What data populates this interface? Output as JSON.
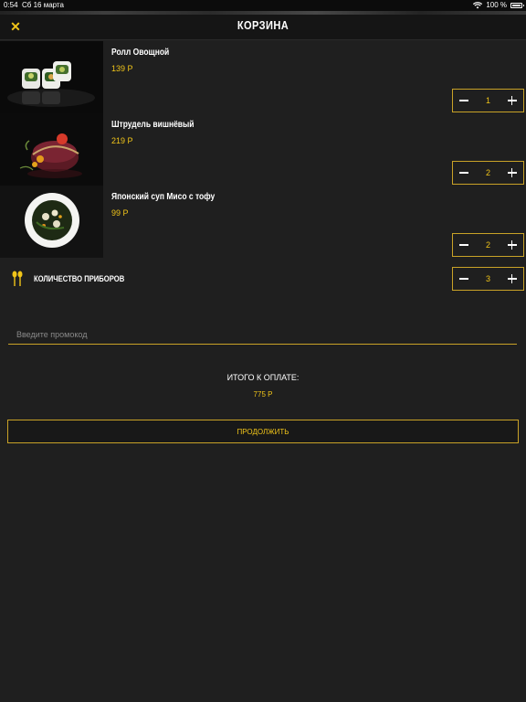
{
  "status_bar": {
    "time": "0:54",
    "date": "Сб 16 марта",
    "battery": "100 %"
  },
  "header": {
    "title": "КОРЗИНА",
    "close_icon": "close-icon"
  },
  "items": [
    {
      "name": "Ролл Овощной",
      "price": "139 Р",
      "qty": "1",
      "image": "sushi-roll-photo"
    },
    {
      "name": "Штрудель вишнёвый",
      "price": "219 Р",
      "qty": "2",
      "image": "strudel-photo"
    },
    {
      "name": "Японский суп Мисо с тофу",
      "price": "99 Р",
      "qty": "2",
      "image": "miso-soup-photo"
    }
  ],
  "cutlery": {
    "label": "КОЛИЧЕСТВО ПРИБОРОВ",
    "qty": "3",
    "icon": "cutlery-icon"
  },
  "promo": {
    "placeholder": "Введите промокод"
  },
  "total": {
    "label": "ИТОГО К ОПЛАТЕ:",
    "value": "775 Р"
  },
  "continue_label": "ПРОДОЛЖИТЬ",
  "colors": {
    "accent": "#f0c419",
    "border": "#c9a227",
    "background": "#1f1f1f"
  }
}
